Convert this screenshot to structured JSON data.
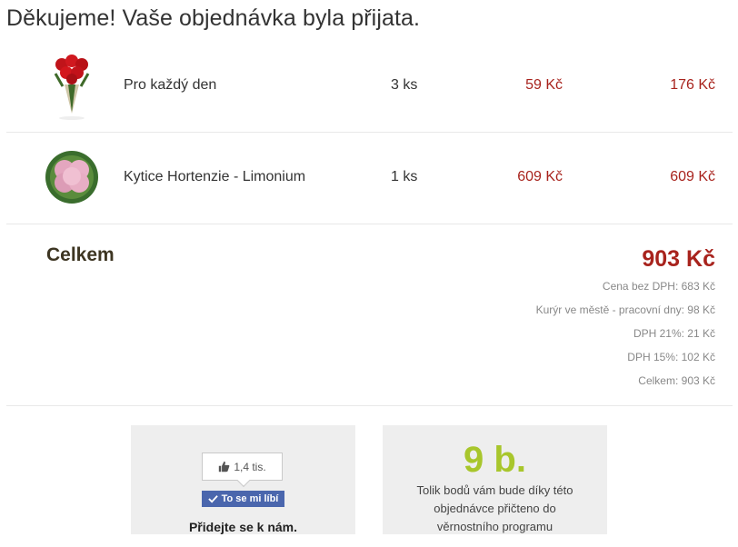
{
  "page": {
    "title": "Děkujeme! Vaše objednávka byla přijata."
  },
  "items": [
    {
      "name": "Pro každý den",
      "qty": "3 ks",
      "unit_price": "59 Kč",
      "total": "176 Kč",
      "image_icon": "red-roses-bouquet"
    },
    {
      "name": "Kytice Hortenzie - Limonium",
      "qty": "1 ks",
      "unit_price": "609 Kč",
      "total": "609 Kč",
      "image_icon": "pink-hydrangea-bouquet"
    }
  ],
  "summary": {
    "label": "Celkem",
    "total": "903 Kč",
    "lines": [
      "Cena bez DPH: 683 Kč",
      "Kurýr ve městě - pracovní dny: 98 Kč",
      "DPH 21%: 21 Kč",
      "DPH 15%: 102 Kč",
      "Celkem: 903 Kč"
    ]
  },
  "facebook": {
    "count": "1,4 tis.",
    "like_label": "To se mi líbí",
    "join_text": "Přidejte se k nám."
  },
  "loyalty": {
    "points": "9 b.",
    "text": "Tolik bodů vám bude díky této objednávce přičteno do věrnostního programu"
  },
  "colors": {
    "price": "#a8231d",
    "points": "#a8c62c",
    "facebook": "#4a66ad",
    "box_bg": "#eeeeee"
  }
}
